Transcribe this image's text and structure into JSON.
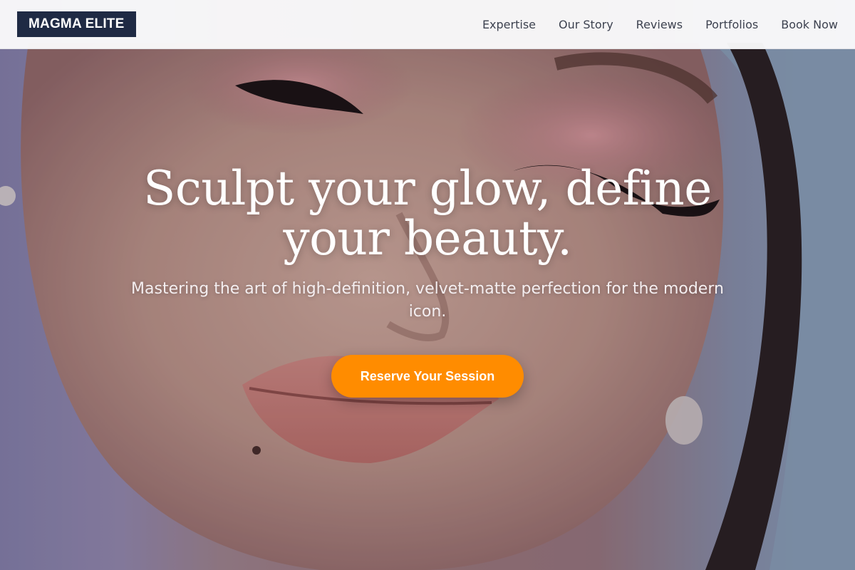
{
  "navbar": {
    "brand": "MAGMA ELITE",
    "links": [
      {
        "label": "Expertise"
      },
      {
        "label": "Our Story"
      },
      {
        "label": "Reviews"
      },
      {
        "label": "Portfolios"
      },
      {
        "label": "Book Now"
      }
    ]
  },
  "hero": {
    "title": "Sculpt your glow, define your beauty.",
    "subtitle": "Mastering the art of high-definition, velvet-matte perfection for the modern icon.",
    "cta_label": "Reserve Your Session",
    "background_image": "close-up portrait of model with pink glitter eyeshadow and winged eyeliner"
  },
  "colors": {
    "brand_bg": "#1f2a44",
    "cta": "#ff8c00",
    "nav_bg": "#fafafb",
    "nav_text": "#3d4250"
  }
}
